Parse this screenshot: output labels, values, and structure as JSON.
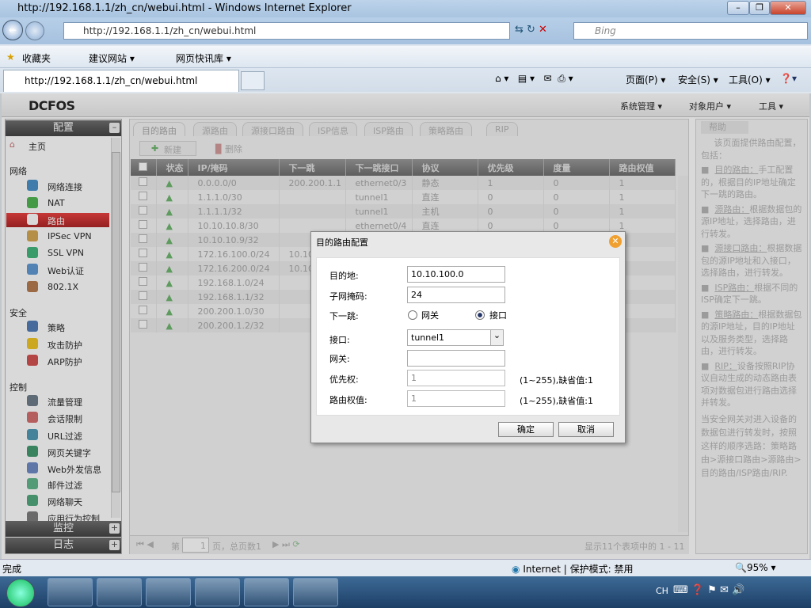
{
  "window": {
    "title": "http://192.168.1.1/zh_cn/webui.html - Windows Internet Explorer",
    "address": "http://192.168.1.1/zh_cn/webui.html",
    "search_placeholder": "Bing",
    "tab_title": "http://192.168.1.1/zh_cn/webui.html"
  },
  "favorites": {
    "label": "收藏夹",
    "items": [
      "建议网站 ▾",
      "网页快讯库 ▾"
    ]
  },
  "commands": [
    "页面(P) ▾",
    "安全(S) ▾",
    "工具(O) ▾"
  ],
  "app": {
    "logo": "DCFOS",
    "menus": [
      "系统管理 ▾",
      "对象用户 ▾",
      "工具 ▾"
    ]
  },
  "sidebar": {
    "config": "配置",
    "home": "主页",
    "groups": [
      {
        "label": "网络",
        "items": [
          "网络连接",
          "NAT",
          "路由",
          "IPSec VPN",
          "SSL VPN",
          "Web认证",
          "802.1X"
        ]
      },
      {
        "label": "安全",
        "items": [
          "策略",
          "攻击防护",
          "ARP防护"
        ]
      },
      {
        "label": "控制",
        "items": [
          "流量管理",
          "会话限制",
          "URL过滤",
          "网页关键字",
          "Web外发信息",
          "邮件过滤",
          "网络聊天",
          "应用行为控制"
        ]
      }
    ],
    "monitor": "监控",
    "log": "日志"
  },
  "tabs": [
    "目的路由",
    "源路由",
    "源接口路由",
    "ISP信息",
    "ISP路由",
    "策略路由",
    "RIP"
  ],
  "toolbar": {
    "new": "新建",
    "delete": "删除"
  },
  "table": {
    "columns": [
      "",
      "状态",
      "IP/掩码",
      "下一跳",
      "下一跳接口",
      "协议",
      "优先级",
      "度量",
      "路由权值"
    ],
    "rows": [
      [
        "0.0.0.0/0",
        "200.200.1.1",
        "ethernet0/3",
        "静态",
        "1",
        "0",
        "1"
      ],
      [
        "1.1.1.0/30",
        "",
        "tunnel1",
        "直连",
        "0",
        "0",
        "1"
      ],
      [
        "1.1.1.1/32",
        "",
        "tunnel1",
        "主机",
        "0",
        "0",
        "1"
      ],
      [
        "10.10.10.8/30",
        "",
        "ethernet0/4",
        "直连",
        "0",
        "0",
        "1"
      ],
      [
        "10.10.10.9/32",
        "",
        "",
        "",
        "",
        "",
        ""
      ],
      [
        "172.16.100.0/24",
        "10.10.",
        "",
        "",
        "",
        "",
        ""
      ],
      [
        "172.16.200.0/24",
        "10.10.",
        "",
        "",
        "",
        "",
        ""
      ],
      [
        "192.168.1.0/24",
        "",
        "",
        "",
        "",
        "",
        ""
      ],
      [
        "192.168.1.1/32",
        "",
        "",
        "",
        "",
        "",
        ""
      ],
      [
        "200.200.1.0/30",
        "",
        "",
        "",
        "",
        "",
        ""
      ],
      [
        "200.200.1.2/32",
        "",
        "",
        "",
        "",
        "",
        ""
      ]
    ]
  },
  "pager": {
    "prefix": "第",
    "page": "1",
    "suffix": "页，总页数1",
    "summary": "显示11个表项中的 1 - 11"
  },
  "help": {
    "title": "帮助",
    "intro": "该页面提供路由配置，包括：",
    "items": [
      {
        "name": "目的路由：",
        "desc": "手工配置的，根据目的IP地址确定下一跳的路由。"
      },
      {
        "name": "源路由：",
        "desc": "根据数据包的源IP地址，选择路由，进行转发。"
      },
      {
        "name": "源接口路由：",
        "desc": "根据数据包的源IP地址和入接口，选择路由，进行转发。"
      },
      {
        "name": "ISP路由：",
        "desc": "根据不同的ISP确定下一跳。"
      },
      {
        "name": "策略路由：",
        "desc": "根据数据包的源IP地址，目的IP地址以及服务类型，选择路由，进行转发。"
      },
      {
        "name": "RIP：",
        "desc": "设备按照RIP协议自动生成的动态路由表项对数据包进行路由选择并转发。"
      }
    ],
    "footer": "当安全网关对进入设备的数据包进行转发时，按照这样的顺序选路：策略路由>源接口路由>源路由>目的路由/ISP路由/RIP."
  },
  "dialog": {
    "title": "目的路由配置",
    "dest_label": "目的地:",
    "dest": "10.10.100.0",
    "mask_label": "子网掩码:",
    "mask": "24",
    "nexthop_label": "下一跳:",
    "opt_gw": "网关",
    "opt_if": "接口",
    "if_label": "接口:",
    "if_value": "tunnel1",
    "gw_label": "网关:",
    "gw": "",
    "prio_label": "优先权:",
    "prio": "1",
    "prio_hint": "(1~255),缺省值:1",
    "weight_label": "路由权值:",
    "weight": "1",
    "weight_hint": "(1~255),缺省值:1",
    "ok": "确定",
    "cancel": "取消"
  },
  "statusbar": {
    "left": "完成",
    "zone": "Internet | 保护模式: 禁用",
    "zoom": "95%"
  },
  "tray": {
    "lang": "CH"
  }
}
